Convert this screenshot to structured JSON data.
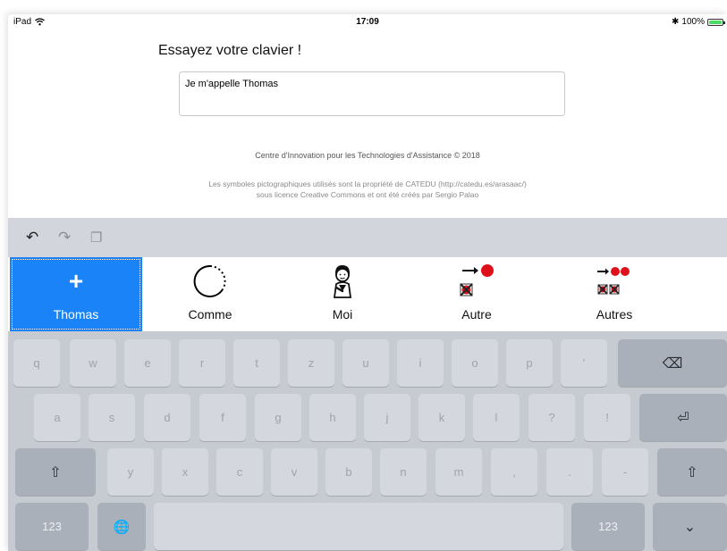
{
  "status_bar": {
    "device": "iPad",
    "time": "17:09",
    "bluetooth": "✱",
    "battery": "100%",
    "battery_level": 1.0,
    "battery_color": "#4cd964"
  },
  "page": {
    "title": "Essayez votre clavier !",
    "input_value": "Je m'appelle Thomas",
    "credits": "Centre d'Innovation pour les Technologies d'Assistance © 2018",
    "license_line1": "Les symboles pictographiques utilisés sont la propriété de CATEDU (http://catedu.es/arasaac/)",
    "license_line2": "sous licence Creative Commons et ont été créés par Sergio Palao"
  },
  "toolbar": {
    "undo_icon": "↶",
    "redo_icon": "↷",
    "paste_icon": "❐"
  },
  "predictions": {
    "active_color": "#1a83f7",
    "items": [
      {
        "label": "Thomas",
        "icon": "plus-icon",
        "glyph": "+"
      },
      {
        "label": "Comme",
        "icon": "dashed-circle-icon"
      },
      {
        "label": "Moi",
        "icon": "person-pictogram-icon"
      },
      {
        "label": "Autre",
        "icon": "arrow-dot-cross-icon"
      },
      {
        "label": "Autres",
        "icon": "arrow-dots-crosses-icon"
      }
    ]
  },
  "keyboard": {
    "row1": [
      "q",
      "w",
      "e",
      "r",
      "t",
      "z",
      "u",
      "i",
      "o",
      "p",
      "'"
    ],
    "row2": [
      "a",
      "s",
      "d",
      "f",
      "g",
      "h",
      "j",
      "k",
      "l",
      "?",
      "!"
    ],
    "row3": [
      "y",
      "x",
      "c",
      "v",
      "b",
      "n",
      "m",
      ",",
      ".",
      "-"
    ],
    "backspace": "⌫",
    "return": "⏎",
    "shift": "⇧",
    "numbers": "123",
    "globe": "🌐",
    "hide": "⌄"
  }
}
